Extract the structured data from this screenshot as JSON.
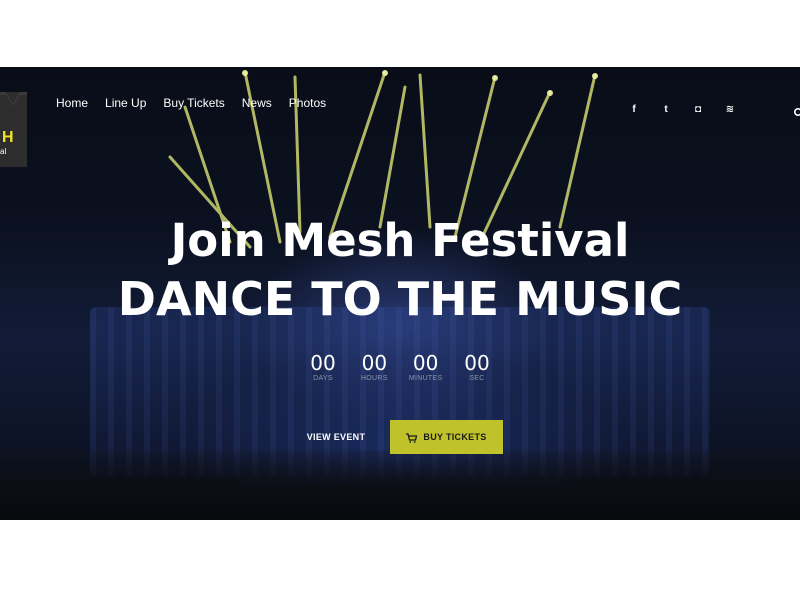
{
  "logo": {
    "letter": "H",
    "subtitle": "al"
  },
  "nav": {
    "items": [
      {
        "label": "Home"
      },
      {
        "label": "Line Up"
      },
      {
        "label": "Buy Tickets"
      },
      {
        "label": "News"
      },
      {
        "label": "Photos"
      }
    ]
  },
  "social": {
    "facebook": "f",
    "twitter": "t",
    "instagram": "◘",
    "spotify": "≋"
  },
  "hero": {
    "title_line1": "Join Mesh Festival",
    "title_line2": "DANCE TO THE MUSIC"
  },
  "countdown": {
    "days": "00",
    "days_label": "DAYS",
    "hours": "00",
    "hours_label": "HOURS",
    "minutes": "00",
    "minutes_label": "MINUTES",
    "seconds": "00",
    "seconds_label": "SEC"
  },
  "buttons": {
    "view_event": "VIEW EVENT",
    "buy_tickets": "BUY TICKETS"
  },
  "colors": {
    "accent": "#bfc22a",
    "logo_accent": "#f4e22a",
    "logo_bg": "#2d2d2d"
  }
}
